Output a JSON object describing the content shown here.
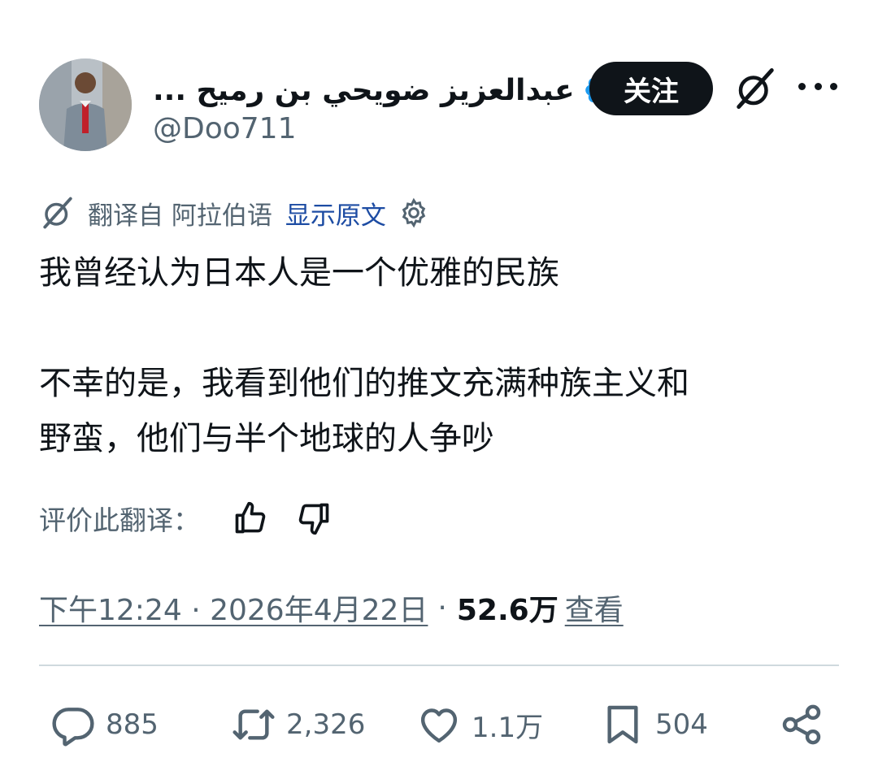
{
  "header": {
    "display_name": "عبدالعزيز ضويحي بن رميح ...",
    "handle": "@Doo711",
    "follow_label": "关注"
  },
  "translation": {
    "translated_from": "翻译自 阿拉伯语",
    "show_original": "显示原文"
  },
  "tweet": {
    "lines": [
      "我曾经认为日本人是一个优雅的民族",
      "不幸的是，我看到他们的推文充满种族主义和",
      "野蛮，他们与半个地球的人争吵"
    ]
  },
  "rating": {
    "label": "评价此翻译："
  },
  "meta": {
    "time_date": "下午12:24 · 2026年4月22日",
    "separator": "·",
    "views_count": "52.6万",
    "views_label": "查看"
  },
  "actions": {
    "replies": "885",
    "reposts": "2,326",
    "likes": "1.1万",
    "bookmarks": "504"
  },
  "colors": {
    "text_primary": "#0f1419",
    "text_secondary": "#536471",
    "link": "#1d4ca3",
    "verified": "#1d9bf0",
    "divider": "#cfd9de"
  },
  "icons": [
    "verified-badge-icon",
    "grok-icon",
    "more-icon",
    "translate-icon",
    "gear-icon",
    "thumbs-up-icon",
    "thumbs-down-icon",
    "reply-icon",
    "repost-icon",
    "like-icon",
    "bookmark-icon",
    "share-icon"
  ]
}
